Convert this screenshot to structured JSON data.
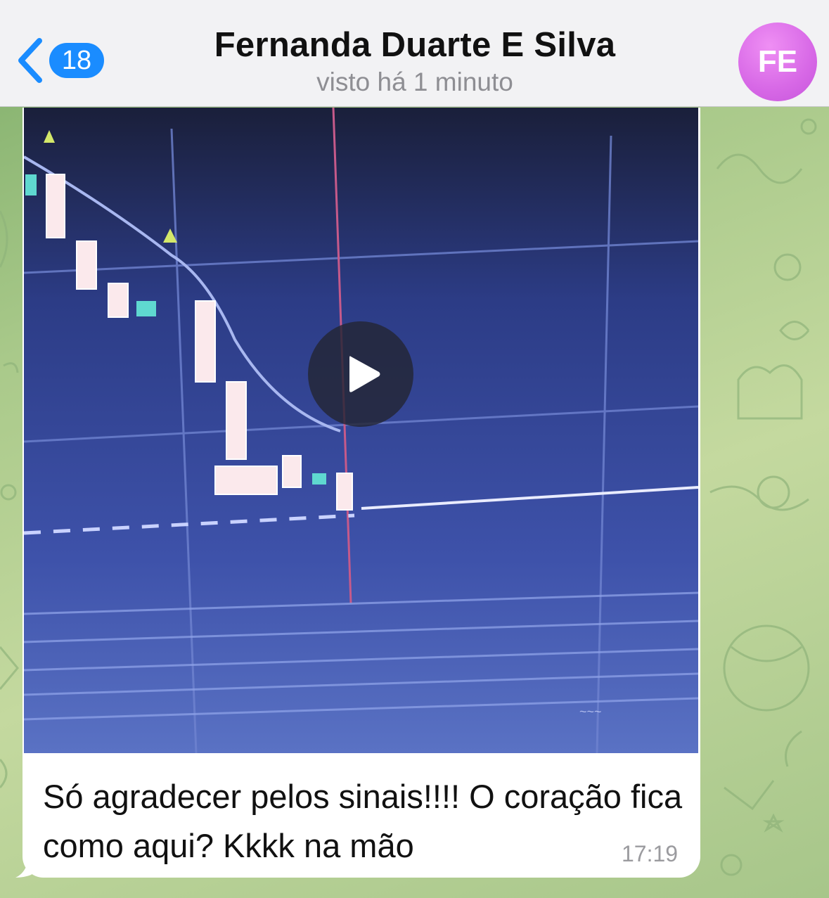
{
  "header": {
    "back_badge": "18",
    "title": "Fernanda Duarte E Silva",
    "status": "visto há 1 minuto",
    "avatar_initials": "FE"
  },
  "message": {
    "text": "Só agradecer pelos sinais!!!! O coração fica como aqui? Kkkk na mão",
    "time": "17:19",
    "media": "video"
  },
  "colors": {
    "accent": "#1a8cff",
    "avatar": "#d768e6",
    "header_bg": "#f2f2f4",
    "wallpaper": "#a9c98a"
  }
}
